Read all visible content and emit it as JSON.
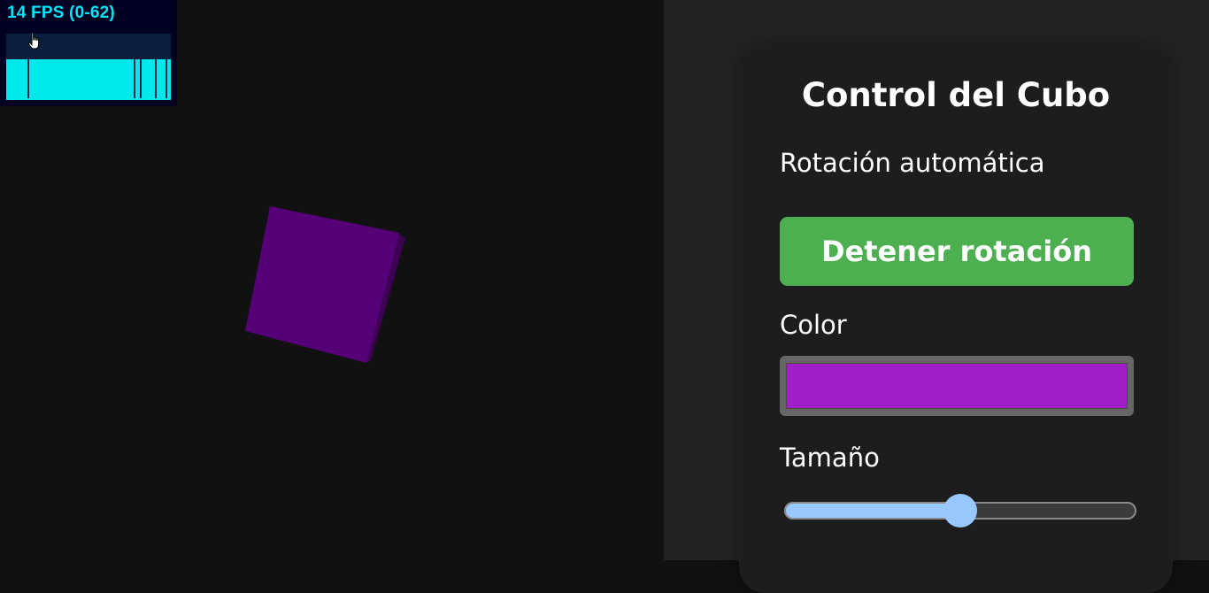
{
  "stats": {
    "fps_label": "14 FPS (0-62)"
  },
  "scene": {
    "background_color": "#111111",
    "cube_color": "#5a0075"
  },
  "controls": {
    "title": "Control del Cubo",
    "rotation_label": "Rotación automática",
    "rotation_button_label": "Detener rotación",
    "color_label": "Color",
    "color_value": "#a020c8",
    "size_label": "Tamaño",
    "size_value_fraction": 0.5
  },
  "colors": {
    "button": "#4caf50",
    "slider_accent": "#99c8ff",
    "fps_text": "#00e5f5"
  },
  "icons": {
    "cursor": "hand-pointer-icon"
  }
}
